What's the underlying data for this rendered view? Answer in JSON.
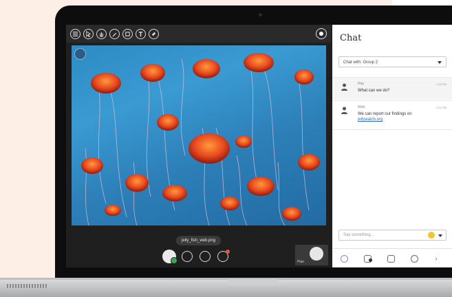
{
  "colors": {
    "background": "#fdeee6",
    "accent_link": "#2a6ebd",
    "presence_online": "#3aa757",
    "notification": "#e05a3a",
    "active_nav": "#9b7fd1"
  },
  "toolbar": {
    "tools": [
      {
        "name": "menu-icon"
      },
      {
        "name": "pointer-icon"
      },
      {
        "name": "hand-icon"
      },
      {
        "name": "pen-icon"
      },
      {
        "name": "shape-icon"
      },
      {
        "name": "text-icon",
        "glyph": "T"
      },
      {
        "name": "eraser-icon"
      }
    ],
    "record_icon": "record-icon"
  },
  "stage": {
    "filename": "jelly_fish_web.png"
  },
  "controls": {
    "items": [
      "avatar",
      "microphone-icon",
      "screen-share-icon",
      "participants-icon"
    ]
  },
  "self_view": {
    "label": "Plan"
  },
  "chat": {
    "title": "Chat",
    "chat_with": "Chat with: Group 2",
    "messages": [
      {
        "name": "Rita",
        "time": "1:20 PM",
        "text": "What can we do?",
        "link": ""
      },
      {
        "name": "Maki",
        "time": "1:20 PM",
        "text": "We can report our findings on",
        "link": "jellywatch.org"
      }
    ],
    "compose_placeholder": "Say something...",
    "nav": [
      "chat-icon",
      "attendees-icon",
      "share-icon",
      "settings-icon"
    ]
  }
}
